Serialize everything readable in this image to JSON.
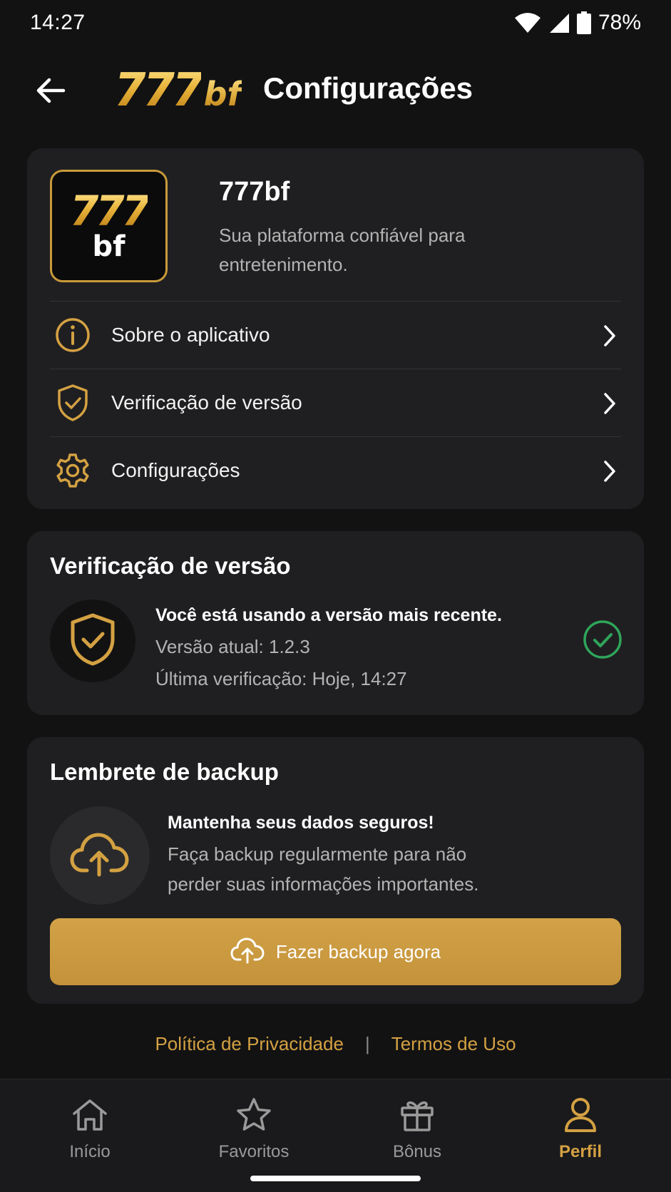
{
  "status_bar": {
    "time": "14:27",
    "battery": "78%",
    "icons": [
      "wifi-icon",
      "signal-icon",
      "battery-icon"
    ]
  },
  "header": {
    "brand_digits": "777",
    "brand_suffix": "bf",
    "title": "Configurações",
    "back_icon": "arrow-left-icon"
  },
  "app_card": {
    "icon_digits": "777",
    "icon_suffix": "bf",
    "name": "777bf",
    "description": "Sua plataforma confiável para entretenimento.",
    "menu": [
      {
        "label": "Sobre o aplicativo",
        "icon": "info-icon"
      },
      {
        "label": "Verificação de versão",
        "icon": "shield-check-icon"
      },
      {
        "label": "Configurações",
        "icon": "gear-icon"
      }
    ]
  },
  "version_card": {
    "title": "Verificação de versão",
    "status": "Você está usando a versão mais recente.",
    "current_version": "Versão atual: 1.2.3",
    "last_check": "Última verificação: Hoje, 14:27",
    "status_icon": "check-circle-icon"
  },
  "backup_card": {
    "title": "Lembrete de backup",
    "headline": "Mantenha seus dados seguros!",
    "description": "Faça backup regularmente para não perder suas informações importantes.",
    "button_label": "Fazer backup agora",
    "icon": "cloud-upload-icon"
  },
  "footer": {
    "privacy": "Política de Privacidade",
    "separator": "|",
    "terms": "Termos de Uso"
  },
  "bottom_nav": {
    "items": [
      {
        "label": "Início",
        "icon": "home-icon",
        "active": false
      },
      {
        "label": "Favoritos",
        "icon": "star-icon",
        "active": false
      },
      {
        "label": "Bônus",
        "icon": "gift-icon",
        "active": false
      },
      {
        "label": "Perfil",
        "icon": "user-icon",
        "active": true
      }
    ]
  },
  "colors": {
    "accent": "#d4a142",
    "background": "#121213",
    "card": "#1f1f21",
    "success": "#2fa55a"
  }
}
